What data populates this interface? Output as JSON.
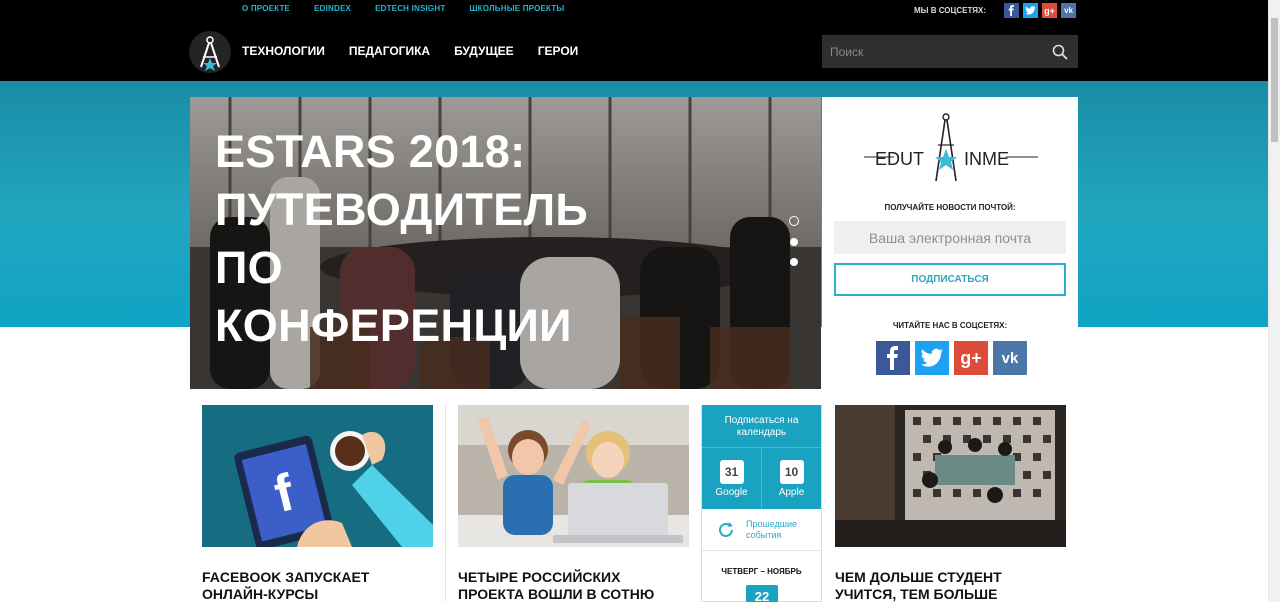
{
  "header": {
    "top_links": [
      "О ПРОЕКТЕ",
      "EDINDEX",
      "EDTECH INSIGHT",
      "ШКОЛЬНЫЕ ПРОЕКТЫ"
    ],
    "social_label": "МЫ В СОЦСЕТЯХ:",
    "nav": [
      "ТЕХНОЛОГИИ",
      "ПЕДАГОГИКА",
      "БУДУЩЕЕ",
      "ГЕРОИ"
    ],
    "search_placeholder": "Поиск"
  },
  "hero": {
    "title": "ESTARS 2018: ПУТЕВОДИТЕЛЬ ПО КОНФЕРЕНЦИИ",
    "slides": 3,
    "active_slide": 1
  },
  "subscribe": {
    "brand": "EDUTAINME",
    "news_label": "ПОЛУЧАЙТЕ НОВОСТИ ПОЧТОЙ:",
    "email_placeholder": "Ваша электронная почта",
    "button": "ПОДПИСАТЬСЯ",
    "social_label": "ЧИТАЙТЕ НАС В СОЦСЕТЯХ:"
  },
  "cards": [
    {
      "title": "FACEBOOK ЗАПУСКАЕТ ОНЛАЙН-КУРСЫ"
    },
    {
      "title": "ЧЕТЫРЕ РОССИЙСКИХ ПРОЕКТА ВОШЛИ В СОТНЮ"
    },
    {
      "title": "ЧЕМ ДОЛЬШЕ СТУДЕНТ УЧИТСЯ, ТЕМ БОЛЬШЕ"
    }
  ],
  "calendar": {
    "head": "Подписаться на календарь",
    "google_num": "31",
    "google": "Google",
    "apple_num": "10",
    "apple": "Apple",
    "past": "Прошедшие события",
    "day_label": "ЧЕТВЕРГ – НОЯБРЬ",
    "day_num": "22"
  },
  "colors": {
    "accent": "#1aa3c0",
    "facebook": "#3b5998",
    "twitter": "#1da1f2",
    "google": "#dd4b39",
    "vk": "#4a76a8"
  }
}
